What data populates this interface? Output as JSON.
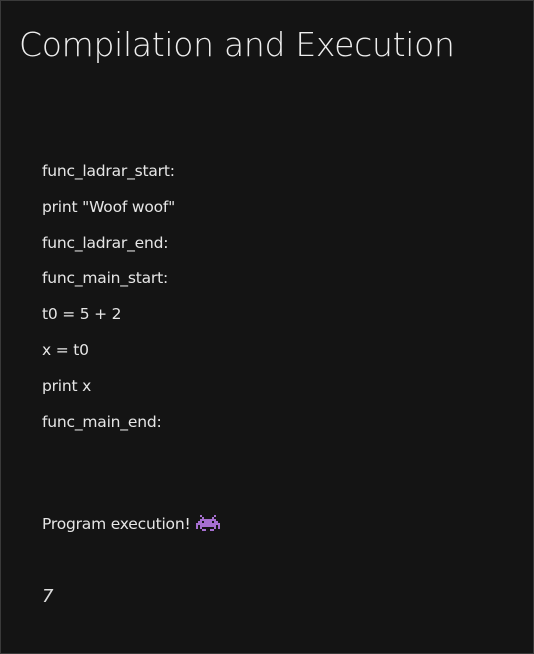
{
  "slide": {
    "title": "Compilation and Execution",
    "code_lines": [
      "func_ladrar_start:",
      "print \"Woof woof\"",
      "func_ladrar_end:",
      "func_main_start:",
      "t0 = 5 + 2",
      "x = t0",
      "print x",
      "func_main_end:"
    ],
    "execution_message": "Program execution!",
    "execution_icon": "alien-monster-icon",
    "output": "7"
  },
  "colors": {
    "background": "#141414",
    "text": "#e6e6e6",
    "icon_purple": "#a66fd0"
  }
}
